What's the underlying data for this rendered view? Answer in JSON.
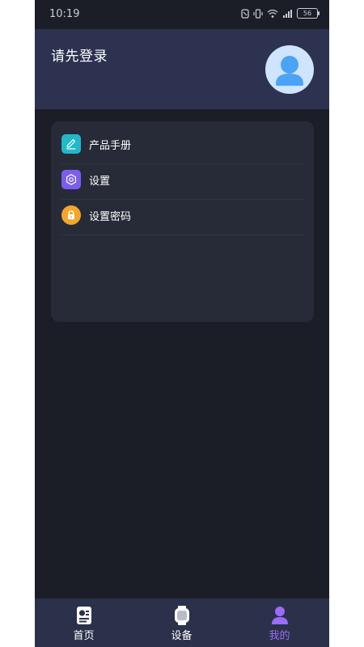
{
  "status_bar": {
    "time": "10:19",
    "battery": "56"
  },
  "header": {
    "title": "请先登录",
    "avatar_icon": "user-avatar-icon"
  },
  "menu": {
    "items": [
      {
        "label": "产品手册",
        "icon": "pencil-icon",
        "color": "#23b8c9"
      },
      {
        "label": "设置",
        "icon": "gear-icon",
        "color": "#7a5ef0"
      },
      {
        "label": "设置密码",
        "icon": "lock-icon",
        "color": "#f4a62a"
      }
    ]
  },
  "tabbar": {
    "tabs": [
      {
        "label": "首页",
        "icon": "home-doc-icon",
        "active": false
      },
      {
        "label": "设备",
        "icon": "watch-icon",
        "active": false
      },
      {
        "label": "我的",
        "icon": "person-icon",
        "active": true
      }
    ],
    "active_color": "#9b6cf6",
    "inactive_color": "#ffffff"
  },
  "colors": {
    "background": "#1b1e26",
    "header_bg": "#2c3250",
    "card_bg": "#272b38",
    "tabbar_bg": "#2b304b"
  }
}
